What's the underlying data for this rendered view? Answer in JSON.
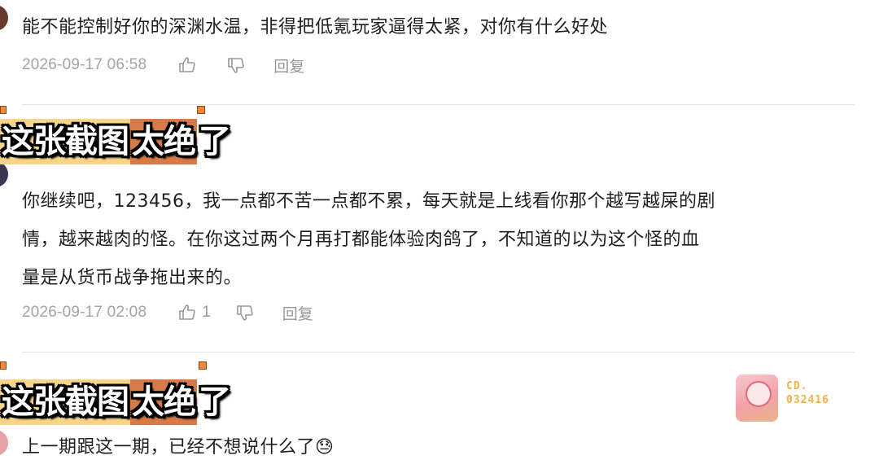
{
  "comments": [
    {
      "text": "能不能控制好你的深渊水温，非得把低氪玩家逼得太紧，对你有什么好处",
      "time": "2026-09-17 06:58",
      "likes": "",
      "reply_label": "回复"
    },
    {
      "text_lines": [
        "你继续吧，123456，我一点都不苦一点都不累，每天就是上线看你那个越写越屎的剧",
        "情，越来越肉的怪。在你这过两个月再打都能体验肉鸽了，不知道的以为这个怪的血",
        "量是从货币战争拖出来的。"
      ],
      "time": "2026-09-17 02:08",
      "likes": "1",
      "reply_label": "回复"
    },
    {
      "text": "上一期跟这一期，已经不想说什么了",
      "emoji": "😓"
    }
  ],
  "captions": [
    {
      "part1": "这张截图",
      "part2": "太绝",
      "part3": "了"
    },
    {
      "part1": "这张截图",
      "part2": "太绝",
      "part3": "了"
    }
  ],
  "badge": {
    "line1": "CD.",
    "line2": "032416"
  },
  "icons": {
    "like": "thumbs-up-icon",
    "dislike": "thumbs-down-icon"
  },
  "colors": {
    "meta_text": "#9499a0",
    "caption_highlight": "#f6d48a",
    "caption_accent": "#d77a4a",
    "badge": "#f3b24a"
  }
}
